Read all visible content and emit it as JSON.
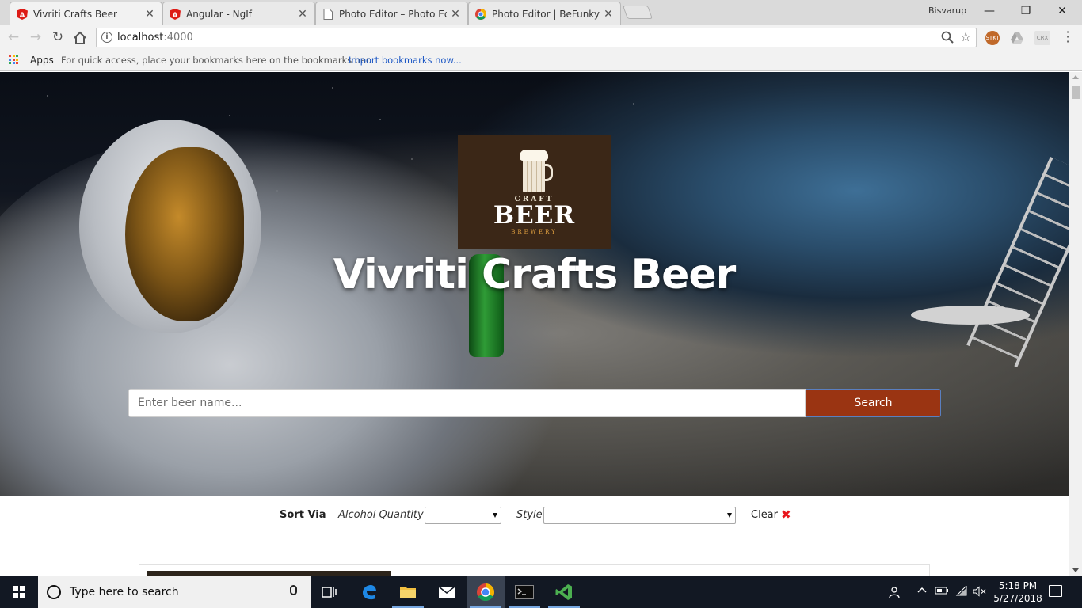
{
  "browser": {
    "tabs": [
      {
        "title": "Vivriti Crafts Beer",
        "active": true
      },
      {
        "title": "Angular - NgIf",
        "active": false
      },
      {
        "title": "Photo Editor – Photo Edit",
        "active": false
      },
      {
        "title": "Photo Editor | BeFunky: F",
        "active": false
      }
    ],
    "profile_name": "Bisvarup",
    "window_controls": {
      "minimize": "—",
      "restore": "❐",
      "close": "✕"
    },
    "url_host": "localhost",
    "url_port": ":4000",
    "extensions": [
      "STKT",
      "CRX"
    ],
    "bookmarks": {
      "apps_label": "Apps",
      "hint": "For quick access, place your bookmarks here on the bookmarks bar.",
      "import_link": "Import bookmarks now..."
    }
  },
  "page": {
    "logo": {
      "craft": "CRAFT",
      "beer": "BEER",
      "brewery": "BREWERY"
    },
    "hero_title": "Vivriti Crafts Beer",
    "search": {
      "placeholder": "Enter beer name...",
      "button_label": "Search"
    },
    "sortbar": {
      "sort_label": "Sort Via",
      "alcohol_label": "Alcohol Quantity",
      "alcohol_value": "",
      "style_label": "Style",
      "style_value": "",
      "clear_label": "Clear",
      "clear_icon": "✖"
    }
  },
  "taskbar": {
    "search_placeholder": "Type here to search",
    "time": "5:18 PM",
    "date": "5/27/2018"
  },
  "colors": {
    "search_button": "#9a3412",
    "clear_icon": "#e8171d",
    "logo_bg": "#3b2717",
    "taskbar": "#121823"
  }
}
